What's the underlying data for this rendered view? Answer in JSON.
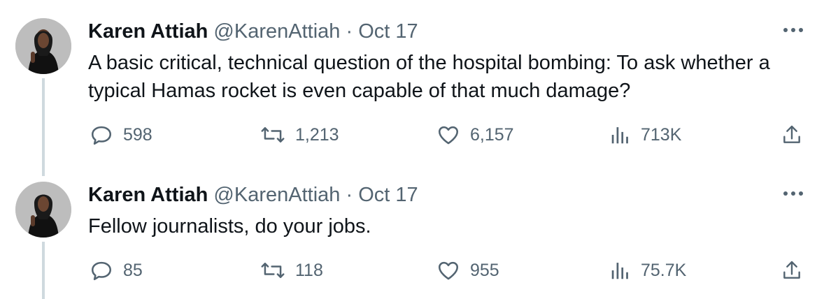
{
  "tweets": [
    {
      "author": {
        "name": "Karen Attiah",
        "handle": "@KarenAttiah"
      },
      "separator": "·",
      "date": "Oct 17",
      "text": "A basic critical, technical question of the hospital bombing: To ask whether a typical Hamas rocket is even capable of that much damage?",
      "stats": {
        "replies": "598",
        "retweets": "1,213",
        "likes": "6,157",
        "views": "713K"
      }
    },
    {
      "author": {
        "name": "Karen Attiah",
        "handle": "@KarenAttiah"
      },
      "separator": "·",
      "date": "Oct 17",
      "text": "Fellow journalists, do your jobs.",
      "stats": {
        "replies": "85",
        "retweets": "118",
        "likes": "955",
        "views": "75.7K"
      }
    }
  ],
  "icons": {
    "more": "more-options-icon",
    "reply": "reply-bubble-icon",
    "retweet": "retweet-arrows-icon",
    "like": "heart-icon",
    "views": "views-bar-chart-icon",
    "share": "share-upload-icon"
  },
  "colors": {
    "text": "#0f1419",
    "secondary": "#536471",
    "thread_line": "#cfd9de"
  }
}
